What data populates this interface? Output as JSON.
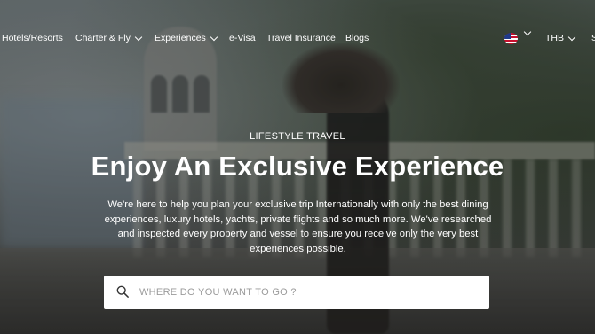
{
  "nav": {
    "items": [
      {
        "label": "Hotels/Resorts",
        "dropdown": false
      },
      {
        "label": "Charter & Fly",
        "dropdown": true
      },
      {
        "label": "Experiences",
        "dropdown": true
      },
      {
        "label": "e-Visa",
        "dropdown": false
      },
      {
        "label": "Travel Insurance",
        "dropdown": false
      },
      {
        "label": "Blogs",
        "dropdown": false
      }
    ],
    "language_icon": "us-flag-icon",
    "currency": "THB",
    "partial_item": "S"
  },
  "hero": {
    "eyebrow": "LIFESTYLE TRAVEL",
    "title": "Enjoy An Exclusive Experience",
    "description": "We're here to help you plan your exclusive trip Internationally with only the best dining experiences, luxury hotels, yachts, private flights and so much more. We've researched and inspected every property and vessel to ensure you receive only the very best experiences possible."
  },
  "search": {
    "placeholder": "WHERE DO YOU WANT TO GO ?",
    "value": ""
  }
}
